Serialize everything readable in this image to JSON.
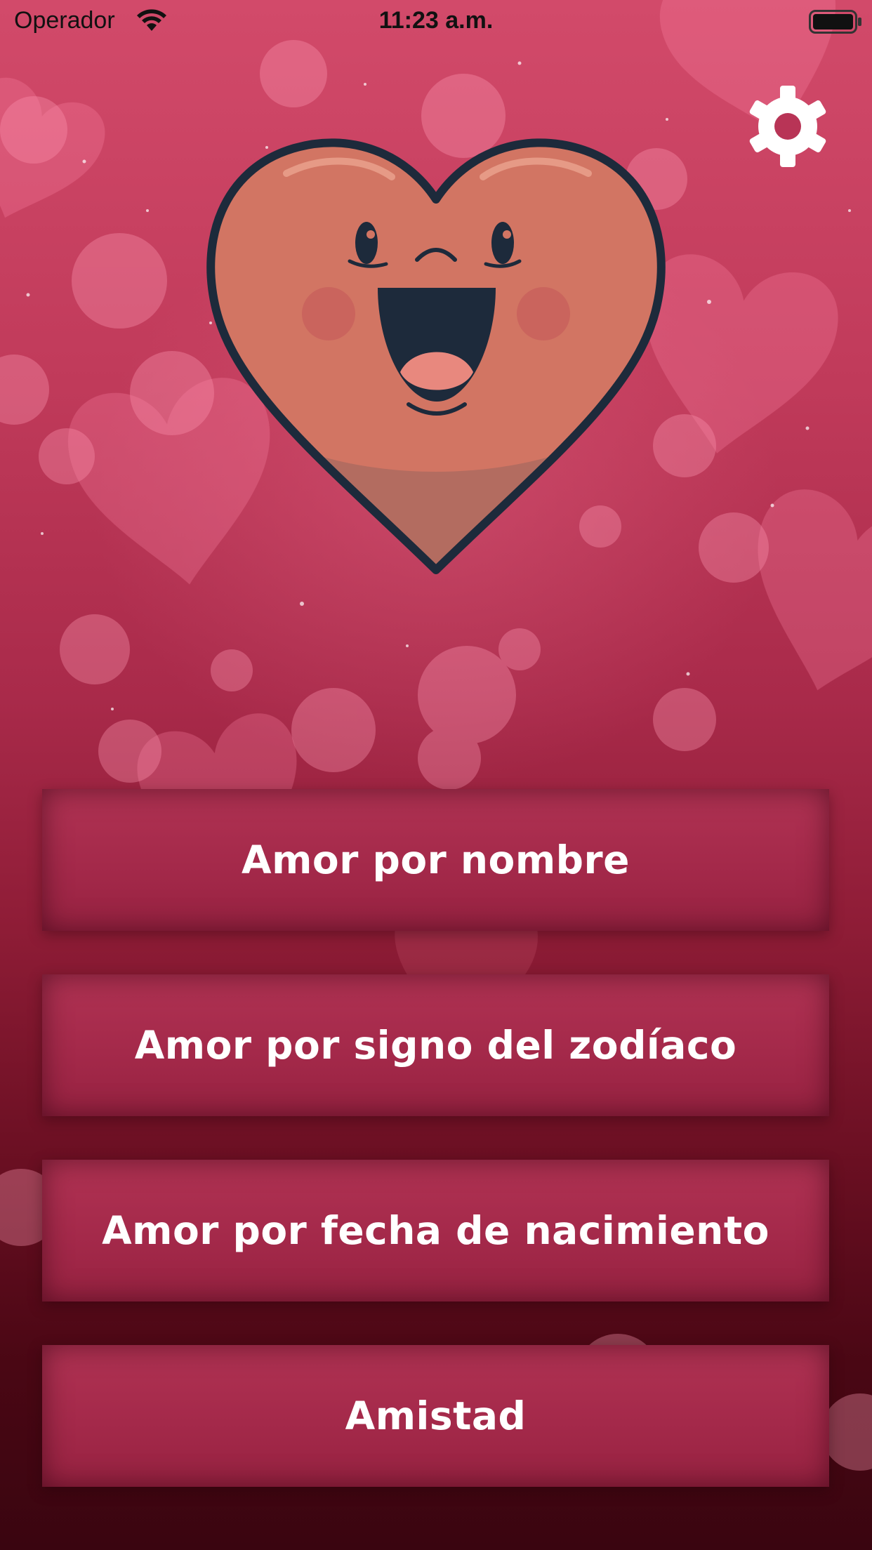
{
  "status_bar": {
    "carrier": "Operador",
    "time": "11:23 a.m.",
    "wifi_icon": "wifi-icon",
    "battery_icon": "battery-icon"
  },
  "header": {
    "settings_icon": "gear-icon"
  },
  "mascot": {
    "icon": "smiling-heart-icon"
  },
  "menu": {
    "items": [
      {
        "label": "Amor por nombre"
      },
      {
        "label": "Amor por signo del zodíaco"
      },
      {
        "label": "Amor por fecha de nacimiento"
      },
      {
        "label": "Amistad"
      }
    ]
  },
  "colors": {
    "background_top": "#d24a6a",
    "background_bottom": "#3a0510",
    "button": "#a4294a",
    "button_text": "#ffffff",
    "heart_fill": "#d27563",
    "heart_outline": "#1d2a3b"
  }
}
